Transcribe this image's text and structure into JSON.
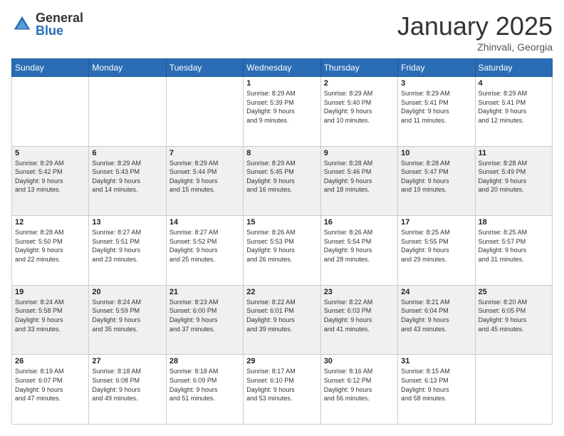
{
  "header": {
    "logo_general": "General",
    "logo_blue": "Blue",
    "month": "January 2025",
    "location": "Zhinvali, Georgia"
  },
  "weekdays": [
    "Sunday",
    "Monday",
    "Tuesday",
    "Wednesday",
    "Thursday",
    "Friday",
    "Saturday"
  ],
  "weeks": [
    [
      {
        "day": "",
        "info": ""
      },
      {
        "day": "",
        "info": ""
      },
      {
        "day": "",
        "info": ""
      },
      {
        "day": "1",
        "info": "Sunrise: 8:29 AM\nSunset: 5:39 PM\nDaylight: 9 hours\nand 9 minutes."
      },
      {
        "day": "2",
        "info": "Sunrise: 8:29 AM\nSunset: 5:40 PM\nDaylight: 9 hours\nand 10 minutes."
      },
      {
        "day": "3",
        "info": "Sunrise: 8:29 AM\nSunset: 5:41 PM\nDaylight: 9 hours\nand 11 minutes."
      },
      {
        "day": "4",
        "info": "Sunrise: 8:29 AM\nSunset: 5:41 PM\nDaylight: 9 hours\nand 12 minutes."
      }
    ],
    [
      {
        "day": "5",
        "info": "Sunrise: 8:29 AM\nSunset: 5:42 PM\nDaylight: 9 hours\nand 13 minutes."
      },
      {
        "day": "6",
        "info": "Sunrise: 8:29 AM\nSunset: 5:43 PM\nDaylight: 9 hours\nand 14 minutes."
      },
      {
        "day": "7",
        "info": "Sunrise: 8:29 AM\nSunset: 5:44 PM\nDaylight: 9 hours\nand 15 minutes."
      },
      {
        "day": "8",
        "info": "Sunrise: 8:29 AM\nSunset: 5:45 PM\nDaylight: 9 hours\nand 16 minutes."
      },
      {
        "day": "9",
        "info": "Sunrise: 8:28 AM\nSunset: 5:46 PM\nDaylight: 9 hours\nand 18 minutes."
      },
      {
        "day": "10",
        "info": "Sunrise: 8:28 AM\nSunset: 5:47 PM\nDaylight: 9 hours\nand 19 minutes."
      },
      {
        "day": "11",
        "info": "Sunrise: 8:28 AM\nSunset: 5:49 PM\nDaylight: 9 hours\nand 20 minutes."
      }
    ],
    [
      {
        "day": "12",
        "info": "Sunrise: 8:28 AM\nSunset: 5:50 PM\nDaylight: 9 hours\nand 22 minutes."
      },
      {
        "day": "13",
        "info": "Sunrise: 8:27 AM\nSunset: 5:51 PM\nDaylight: 9 hours\nand 23 minutes."
      },
      {
        "day": "14",
        "info": "Sunrise: 8:27 AM\nSunset: 5:52 PM\nDaylight: 9 hours\nand 25 minutes."
      },
      {
        "day": "15",
        "info": "Sunrise: 8:26 AM\nSunset: 5:53 PM\nDaylight: 9 hours\nand 26 minutes."
      },
      {
        "day": "16",
        "info": "Sunrise: 8:26 AM\nSunset: 5:54 PM\nDaylight: 9 hours\nand 28 minutes."
      },
      {
        "day": "17",
        "info": "Sunrise: 8:25 AM\nSunset: 5:55 PM\nDaylight: 9 hours\nand 29 minutes."
      },
      {
        "day": "18",
        "info": "Sunrise: 8:25 AM\nSunset: 5:57 PM\nDaylight: 9 hours\nand 31 minutes."
      }
    ],
    [
      {
        "day": "19",
        "info": "Sunrise: 8:24 AM\nSunset: 5:58 PM\nDaylight: 9 hours\nand 33 minutes."
      },
      {
        "day": "20",
        "info": "Sunrise: 8:24 AM\nSunset: 5:59 PM\nDaylight: 9 hours\nand 35 minutes."
      },
      {
        "day": "21",
        "info": "Sunrise: 8:23 AM\nSunset: 6:00 PM\nDaylight: 9 hours\nand 37 minutes."
      },
      {
        "day": "22",
        "info": "Sunrise: 8:22 AM\nSunset: 6:01 PM\nDaylight: 9 hours\nand 39 minutes."
      },
      {
        "day": "23",
        "info": "Sunrise: 8:22 AM\nSunset: 6:03 PM\nDaylight: 9 hours\nand 41 minutes."
      },
      {
        "day": "24",
        "info": "Sunrise: 8:21 AM\nSunset: 6:04 PM\nDaylight: 9 hours\nand 43 minutes."
      },
      {
        "day": "25",
        "info": "Sunrise: 8:20 AM\nSunset: 6:05 PM\nDaylight: 9 hours\nand 45 minutes."
      }
    ],
    [
      {
        "day": "26",
        "info": "Sunrise: 8:19 AM\nSunset: 6:07 PM\nDaylight: 9 hours\nand 47 minutes."
      },
      {
        "day": "27",
        "info": "Sunrise: 8:18 AM\nSunset: 6:08 PM\nDaylight: 9 hours\nand 49 minutes."
      },
      {
        "day": "28",
        "info": "Sunrise: 8:18 AM\nSunset: 6:09 PM\nDaylight: 9 hours\nand 51 minutes."
      },
      {
        "day": "29",
        "info": "Sunrise: 8:17 AM\nSunset: 6:10 PM\nDaylight: 9 hours\nand 53 minutes."
      },
      {
        "day": "30",
        "info": "Sunrise: 8:16 AM\nSunset: 6:12 PM\nDaylight: 9 hours\nand 56 minutes."
      },
      {
        "day": "31",
        "info": "Sunrise: 8:15 AM\nSunset: 6:13 PM\nDaylight: 9 hours\nand 58 minutes."
      },
      {
        "day": "",
        "info": ""
      }
    ]
  ]
}
